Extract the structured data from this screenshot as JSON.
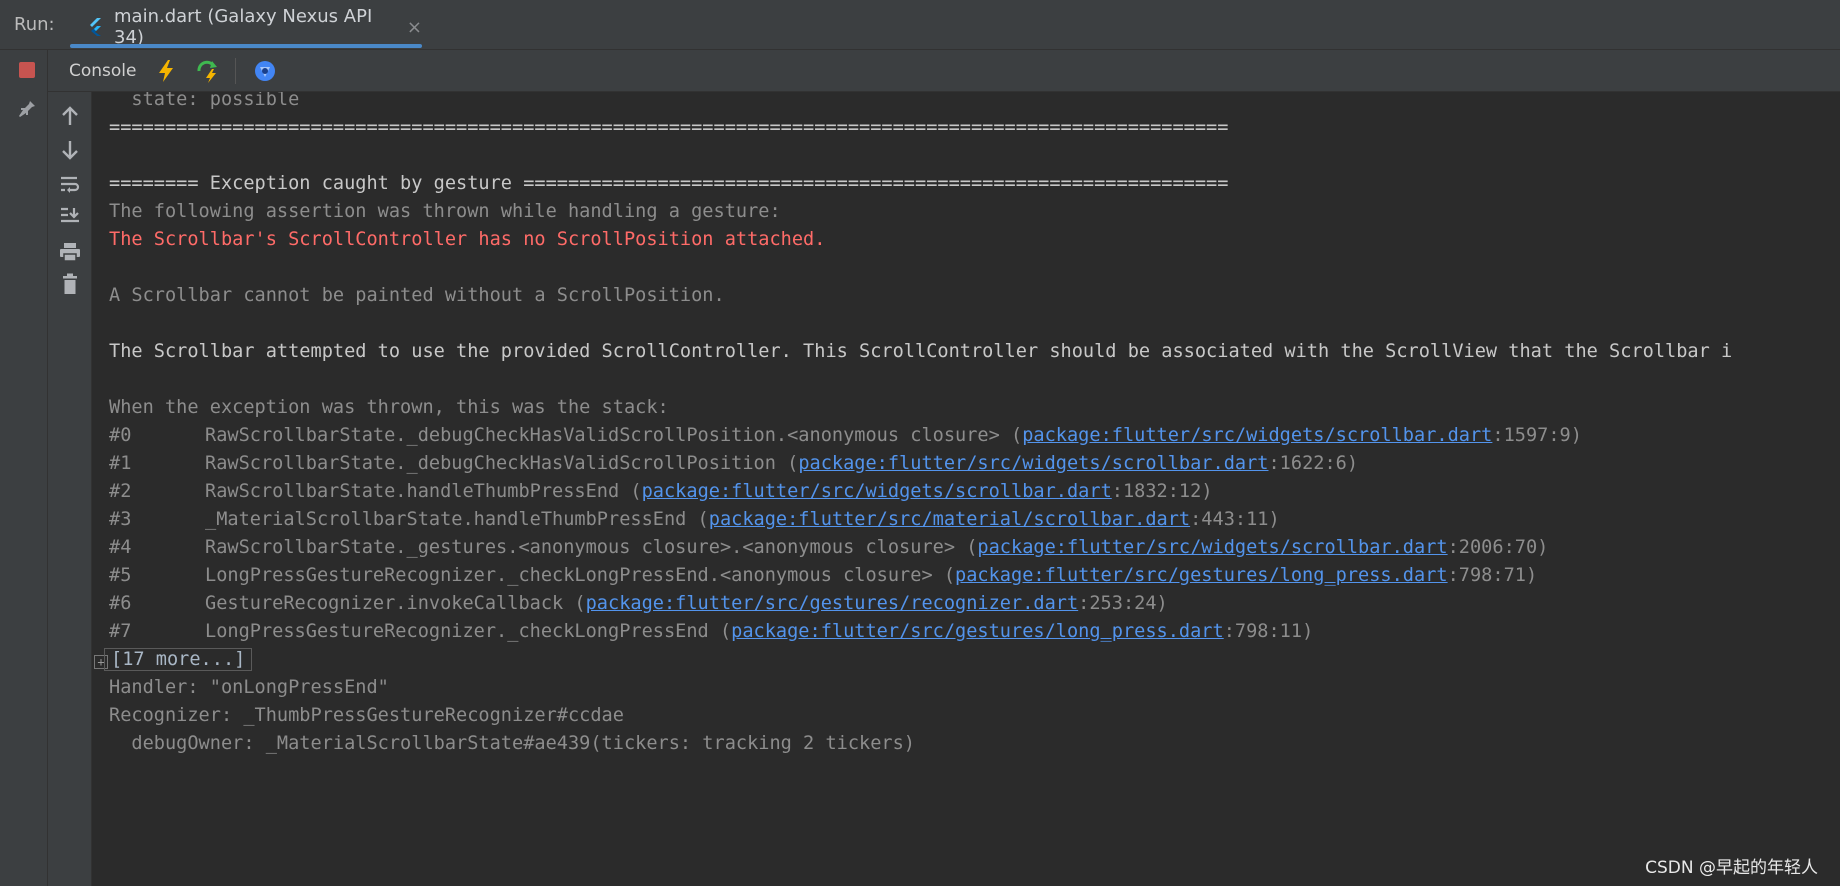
{
  "run_bar": {
    "label": "Run:",
    "tab_title": "main.dart (Galaxy Nexus API 34)",
    "close_glyph": "×"
  },
  "toolbar": {
    "console_label": "Console"
  },
  "console": {
    "lines": [
      {
        "text": "  state: possible",
        "style": "gray"
      },
      {
        "text": "====================================================================================================",
        "style": "white"
      },
      {
        "text": "",
        "style": "gray"
      },
      {
        "text": "======== Exception caught by gesture ===============================================================",
        "style": "white"
      },
      {
        "text": "The following assertion was thrown while handling a gesture:",
        "style": "gray"
      },
      {
        "text": "The Scrollbar's ScrollController has no ScrollPosition attached.",
        "style": "red"
      },
      {
        "text": "",
        "style": "gray"
      },
      {
        "text": "A Scrollbar cannot be painted without a ScrollPosition.",
        "style": "gray"
      },
      {
        "text": "",
        "style": "gray"
      },
      {
        "text": "The Scrollbar attempted to use the provided ScrollController. This ScrollController should be associated with the ScrollView that the Scrollbar i",
        "style": "white"
      },
      {
        "text": "",
        "style": "gray"
      },
      {
        "text": "When the exception was thrown, this was the stack:",
        "style": "gray"
      }
    ],
    "stack": [
      {
        "num": "#0",
        "method": "RawScrollbarState._debugCheckHasValidScrollPosition.<anonymous closure> (",
        "link": "package:flutter/src/widgets/scrollbar.dart",
        "pos": ":1597:9)"
      },
      {
        "num": "#1",
        "method": "RawScrollbarState._debugCheckHasValidScrollPosition (",
        "link": "package:flutter/src/widgets/scrollbar.dart",
        "pos": ":1622:6)"
      },
      {
        "num": "#2",
        "method": "RawScrollbarState.handleThumbPressEnd (",
        "link": "package:flutter/src/widgets/scrollbar.dart",
        "pos": ":1832:12)"
      },
      {
        "num": "#3",
        "method": "_MaterialScrollbarState.handleThumbPressEnd (",
        "link": "package:flutter/src/material/scrollbar.dart",
        "pos": ":443:11)"
      },
      {
        "num": "#4",
        "method": "RawScrollbarState._gestures.<anonymous closure>.<anonymous closure> (",
        "link": "package:flutter/src/widgets/scrollbar.dart",
        "pos": ":2006:70)"
      },
      {
        "num": "#5",
        "method": "LongPressGestureRecognizer._checkLongPressEnd.<anonymous closure> (",
        "link": "package:flutter/src/gestures/long_press.dart",
        "pos": ":798:71)"
      },
      {
        "num": "#6",
        "method": "GestureRecognizer.invokeCallback (",
        "link": "package:flutter/src/gestures/recognizer.dart",
        "pos": ":253:24)"
      },
      {
        "num": "#7",
        "method": "LongPressGestureRecognizer._checkLongPressEnd (",
        "link": "package:flutter/src/gestures/long_press.dart",
        "pos": ":798:11)"
      }
    ],
    "more_label": "[17 more...]",
    "expand_glyph": "+",
    "tail": [
      {
        "text": "Handler: \"onLongPressEnd\"",
        "style": "gray"
      },
      {
        "text": "Recognizer: _ThumbPressGestureRecognizer#ccdae",
        "style": "gray"
      },
      {
        "text": "  debugOwner: _MaterialScrollbarState#ae439(tickers: tracking 2 tickers)",
        "style": "gray"
      }
    ]
  },
  "watermark": "CSDN @早起的年轻人",
  "colors": {
    "error": "#ff6b68",
    "link": "#5394ec",
    "stop": "#c75450",
    "accent": "#4a88c7"
  }
}
